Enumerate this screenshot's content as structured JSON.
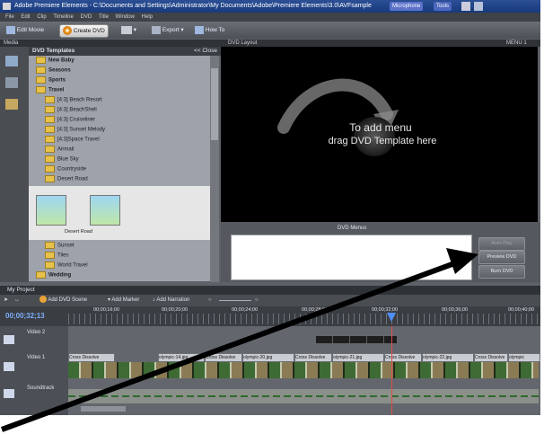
{
  "window": {
    "title": "Adobe Premiere Elements - C:\\Documents and Settings\\Administrator\\My Documents\\Adobe\\Premiere Elements\\3.0\\AVFsample",
    "microphone_label": "Microphone",
    "tools_label": "Tools"
  },
  "menubar": [
    "File",
    "Edit",
    "Clip",
    "Timeline",
    "DVD",
    "Title",
    "Window",
    "Help"
  ],
  "toolbar": {
    "edit_movie": "Edit Movie",
    "create_dvd": "Create DVD",
    "export": "Export",
    "how_to": "How To"
  },
  "media_panel": {
    "header": "Media",
    "templates_label": "DVD Templates",
    "close_label": "<< Close",
    "tree_top": [
      "New Baby",
      "Seasons",
      "Sports",
      "Travel",
      "[4:3] Beach Resort",
      "[4:3] BeachShell",
      "[4:3] Cruiseliner",
      "[4:3] Sunset Melody",
      "[4:3]Space Travel",
      "Airmail",
      "Blue Sky",
      "Countryside",
      "Desert Road"
    ],
    "thumb_caption": "Desert Road",
    "tree_bottom": [
      "Sunset",
      "Tiles",
      "World Travel",
      "Wedding"
    ]
  },
  "dvd_layout": {
    "header": "DVD Layout",
    "header_right": "MENU 1",
    "instruction_line1": "To add menu",
    "instruction_line2": "drag DVD Template here",
    "menus_label": "DVD Menus",
    "auto_play": "Auto-Play",
    "preview_dvd": "Preview DVD",
    "burn_dvd": "Burn DVD"
  },
  "project": {
    "header": "My Project",
    "add_dvd_scene": "Add DVD Scene",
    "add_marker": "Add Marker",
    "add_narration": "Add Narration",
    "timecode": "00;00;32;13",
    "ruler_ticks": [
      "00;00;16;00",
      "00;00;20;00",
      "00;00;24;00",
      "00;00;28;00",
      "00;00;32;00",
      "00;00;36;00",
      "00;00;40;00"
    ],
    "tracks": {
      "video2": "Video 2",
      "video1": "Video 1",
      "soundtrack": "Soundtrack"
    },
    "clips": [
      "Cross Dissolve",
      "olympic-14.jpg",
      "Cross Dissolve",
      "olympic-20.jpg",
      "Cross Dissolve",
      "olympic-21.jpg",
      "Cross Dissolve",
      "olympic-22.jpg",
      "Cross Dissolve",
      "olympic"
    ]
  },
  "colors": {
    "titlebar": "#173a7d",
    "panel_bg": "#5d6168",
    "stage_bg": "#000000",
    "folder": "#e7c24b",
    "playhead": "#e24c4c"
  }
}
